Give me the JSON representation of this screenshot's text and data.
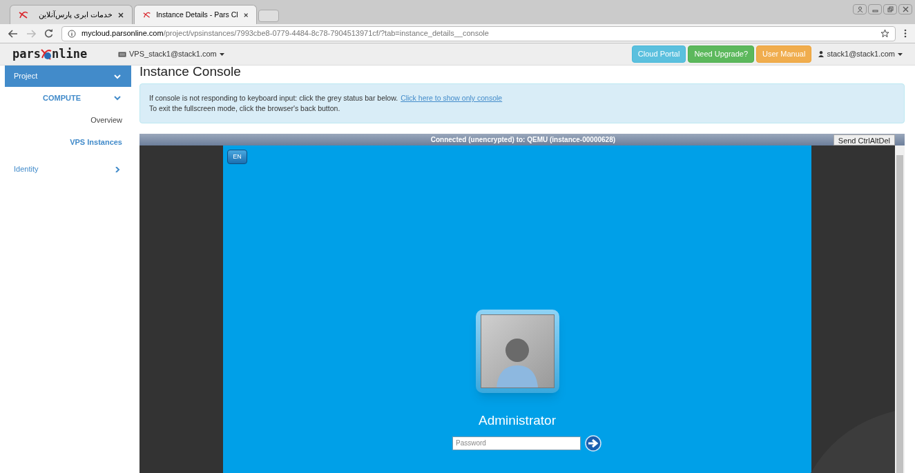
{
  "browser": {
    "tabs": [
      {
        "title": "خدمات ابری پارس‌آنلاین",
        "selected": false
      },
      {
        "title": "Instance Details - Pars Cl",
        "selected": true
      }
    ],
    "url": {
      "host": "mycloud.parsonline.com",
      "path": "/project/vpsinstances/7993cbe8-0779-4484-8c78-7904513971cf/?tab=instance_details__console"
    }
  },
  "navbar": {
    "logo": {
      "left": "pars",
      "right": "nline"
    },
    "project": "VPS_stack1@stack1.com",
    "buttons": [
      {
        "label": "Cloud Portal",
        "kind": "info"
      },
      {
        "label": "Need Upgrade?",
        "kind": "success"
      },
      {
        "label": "User Manual",
        "kind": "warning"
      }
    ],
    "user": "stack1@stack1.com"
  },
  "sidebar": {
    "items": [
      {
        "label": "Project",
        "expanded": true,
        "children": [
          {
            "label": "COMPUTE",
            "expanded": true,
            "children": [
              {
                "label": "Overview",
                "selected": false
              },
              {
                "label": "VPS Instances",
                "selected": true
              }
            ]
          }
        ]
      },
      {
        "label": "Identity",
        "expanded": false
      }
    ]
  },
  "page": {
    "title": "Instance Console",
    "alert": {
      "line1": "If console is not responding to keyboard input: click the grey status bar below.",
      "link": "Click here to show only console",
      "line2": "To exit the fullscreen mode, click the browser's back button."
    },
    "console": {
      "status": "Connected (unencrypted) to: QEMU (instance-00000628)",
      "button": "Send CtrlAltDel",
      "screen": {
        "language": "EN",
        "username": "Administrator",
        "password_placeholder": "Password"
      }
    }
  }
}
